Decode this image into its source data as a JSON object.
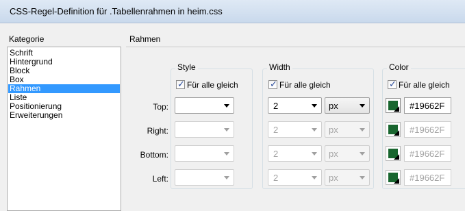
{
  "window": {
    "title": "CSS-Regel-Definition für .Tabellenrahmen in heim.css"
  },
  "category": {
    "header": "Kategorie",
    "items": [
      "Schrift",
      "Hintergrund",
      "Block",
      "Box",
      "Rahmen",
      "Liste",
      "Positionierung",
      "Erweiterungen"
    ],
    "selected": "Rahmen"
  },
  "panel": {
    "header": "Rahmen"
  },
  "groups": {
    "style": {
      "title": "Style",
      "same_label": "Für alle gleich",
      "same_checked": true
    },
    "width": {
      "title": "Width",
      "same_label": "Für alle gleich",
      "same_checked": true
    },
    "color": {
      "title": "Color",
      "same_label": "Für alle gleich",
      "same_checked": true
    }
  },
  "sides": {
    "top": {
      "label": "Top:",
      "style": "",
      "width": "2",
      "unit": "px",
      "color": "#19662F",
      "enabled": true
    },
    "right": {
      "label": "Right:",
      "style": "",
      "width": "2",
      "unit": "px",
      "color": "#19662F",
      "enabled": false
    },
    "bottom": {
      "label": "Bottom:",
      "style": "",
      "width": "2",
      "unit": "px",
      "color": "#19662F",
      "enabled": false
    },
    "left": {
      "label": "Left:",
      "style": "",
      "width": "2",
      "unit": "px",
      "color": "#19662F",
      "enabled": false
    }
  },
  "swatch_color": "#19662F"
}
